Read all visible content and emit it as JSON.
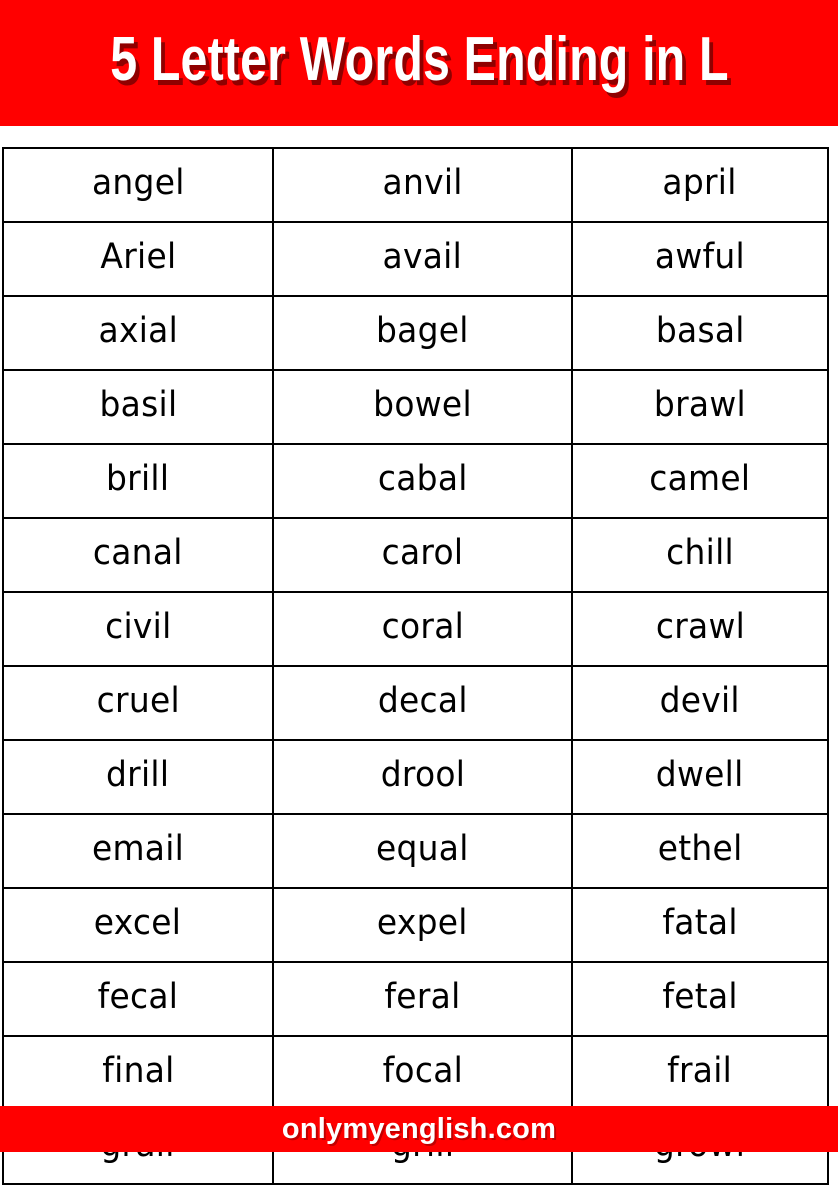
{
  "header": {
    "title": "5 Letter Words Ending in L",
    "background_color": "#ff0000",
    "text_color": "#ffffff",
    "shadow_color": "#8f0000"
  },
  "table": {
    "columns": 3,
    "rows": 14,
    "border_color": "#000000",
    "cells": [
      [
        "angel",
        "anvil",
        "april"
      ],
      [
        "Ariel",
        "avail",
        "awful"
      ],
      [
        "axial",
        "bagel",
        "basal"
      ],
      [
        "basil",
        "bowel",
        "brawl"
      ],
      [
        "brill",
        "cabal",
        "camel"
      ],
      [
        "canal",
        "carol",
        "chill"
      ],
      [
        "civil",
        "coral",
        "crawl"
      ],
      [
        "cruel",
        "decal",
        "devil"
      ],
      [
        "drill",
        "drool",
        "dwell"
      ],
      [
        "email",
        "equal",
        "ethel"
      ],
      [
        "excel",
        "expel",
        "fatal"
      ],
      [
        "fecal",
        "feral",
        "fetal"
      ],
      [
        "final",
        "focal",
        "frail"
      ],
      [
        "grail",
        "grill",
        "growl"
      ]
    ]
  },
  "footer": {
    "text": "onlymyenglish.com",
    "background_color": "#ff0000",
    "text_color": "#ffffff"
  }
}
